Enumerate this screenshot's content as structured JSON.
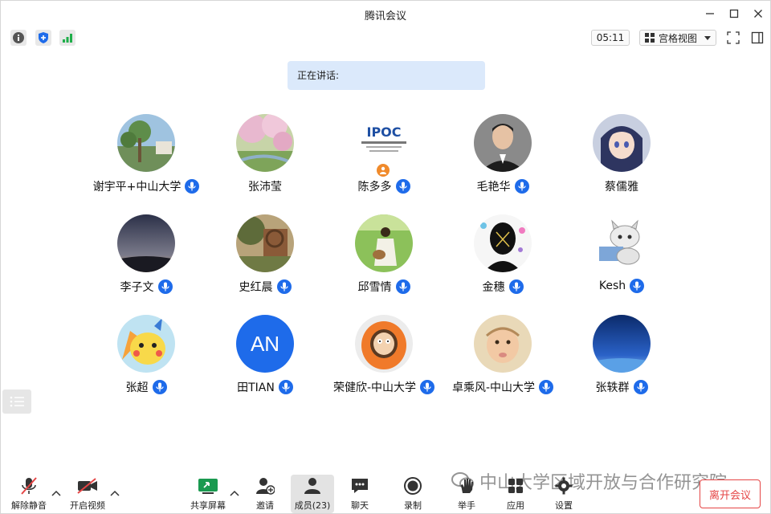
{
  "window": {
    "title": "腾讯会议"
  },
  "toolbar": {
    "timer": "05:11",
    "view_mode": "宫格视图"
  },
  "speaking": {
    "label": "正在讲话:"
  },
  "participants": [
    {
      "name": "谢宇平+中山大学",
      "muted": false,
      "avatar": "photo-garden"
    },
    {
      "name": "张沛莹",
      "muted": false,
      "avatar": "photo-blossom"
    },
    {
      "name": "陈多多",
      "muted": false,
      "avatar": "logo-ipoc",
      "host": true
    },
    {
      "name": "毛艳华",
      "muted": false,
      "avatar": "photo-man-suit"
    },
    {
      "name": "蔡儒雅",
      "muted": false,
      "avatar": "anime-girl"
    },
    {
      "name": "李子文",
      "muted": false,
      "avatar": "photo-dusk"
    },
    {
      "name": "史红晨",
      "muted": false,
      "avatar": "painting-mill"
    },
    {
      "name": "邱雪情",
      "muted": false,
      "avatar": "photo-girl-field"
    },
    {
      "name": "金穗",
      "muted": false,
      "avatar": "silhouette-art"
    },
    {
      "name": "Kesh",
      "muted": false,
      "avatar": "cartoon-cat"
    },
    {
      "name": "张超",
      "muted": false,
      "avatar": "cartoon-pikachu"
    },
    {
      "name": "田TIAN",
      "muted": false,
      "avatar": "initials",
      "initials": "AN"
    },
    {
      "name": "荣健欣-中山大学",
      "muted": false,
      "avatar": "cartoon-kenny"
    },
    {
      "name": "卓乘风-中山大学",
      "muted": false,
      "avatar": "photo-baby"
    },
    {
      "name": "张轶群",
      "muted": false,
      "avatar": "photo-earth-sky"
    }
  ],
  "bottom": {
    "unmute": "解除静音",
    "start_video": "开启视频",
    "share_screen": "共享屏幕",
    "invite": "邀请",
    "members": "成员(23)",
    "chat": "聊天",
    "record": "录制",
    "raise_hand": "举手",
    "apps": "应用",
    "settings": "设置",
    "leave": "离开会议"
  },
  "watermark": "中山大学区域开放与合作研究院",
  "colors": {
    "accent": "#1e6bea",
    "leave": "#e54545",
    "speaking_bg": "#dbe9fb"
  }
}
